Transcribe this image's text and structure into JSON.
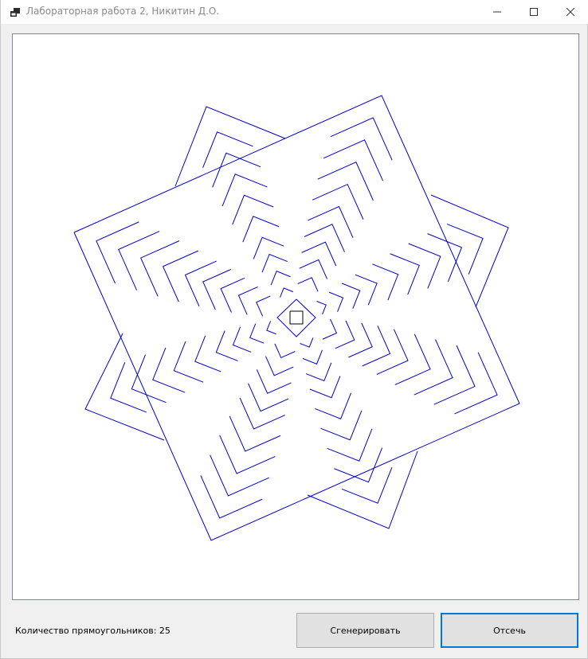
{
  "window": {
    "title": "Лабораторная работа 2, Никитин Д.О."
  },
  "title_icon": "app-window-icon",
  "caption_buttons": [
    "minimize-icon",
    "maximize-icon",
    "close-icon"
  ],
  "status": {
    "rectangle_count_label": "Количество прямоугольников: 25"
  },
  "buttons": {
    "generate_label": "Сгенерировать",
    "clip_label": "Отсечь"
  },
  "drawing": {
    "line_color": "#0000cc",
    "clip_window_color": "#000000"
  }
}
